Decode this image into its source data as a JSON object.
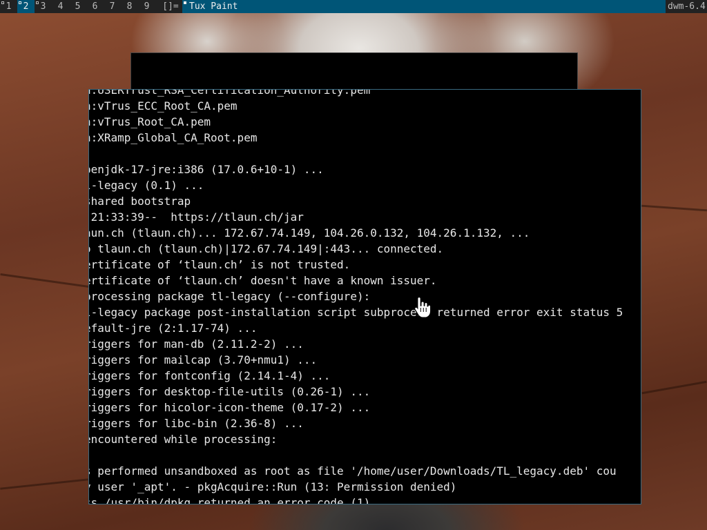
{
  "bar": {
    "tags": [
      {
        "label": "1",
        "occupied": true,
        "selected": false
      },
      {
        "label": "2",
        "occupied": true,
        "selected": true
      },
      {
        "label": "3",
        "occupied": true,
        "selected": false
      },
      {
        "label": "4",
        "occupied": false,
        "selected": false
      },
      {
        "label": "5",
        "occupied": false,
        "selected": false
      },
      {
        "label": "6",
        "occupied": false,
        "selected": false
      },
      {
        "label": "7",
        "occupied": false,
        "selected": false
      },
      {
        "label": "8",
        "occupied": false,
        "selected": false
      },
      {
        "label": "9",
        "occupied": false,
        "selected": false
      }
    ],
    "layout_symbol": "[]=",
    "window_title": "Tux Paint",
    "status_text": "dwm-6.4"
  },
  "colors": {
    "bar_bg": "#222222",
    "bar_fg": "#bbbbbb",
    "selected_bg": "#005577",
    "selected_fg": "#eeeeee",
    "terminal_bg": "#000000",
    "terminal_fg": "#e8e8e8"
  },
  "icons": {
    "cursor": "hand-pointer-icon"
  },
  "terminal": {
    "lines": [
      "n:USERTrust_RSA_Certification_Authority.pem",
      "n:vTrus_ECC_Root_CA.pem",
      "n:vTrus_Root_CA.pem",
      "n:XRamp_Global_CA_Root.pem",
      "",
      "penjdk-17-jre:i386 (17.0.6+10-1) ...",
      "l-legacy (0.1) ...",
      "shared bootstrap",
      " 21:33:39--  https://tlaun.ch/jar",
      "aun.ch (tlaun.ch)... 172.67.74.149, 104.26.0.132, 104.26.1.132, ...",
      "o tlaun.ch (tlaun.ch)|172.67.74.149|:443... connected.",
      "ertificate of ‘tlaun.ch’ is not trusted.",
      "ertificate of ‘tlaun.ch’ doesn't have a known issuer.",
      "processing package tl-legacy (--configure):",
      "l-legacy package post-installation script subprocess returned error exit status 5",
      "efault-jre (2:1.17-74) ...",
      "riggers for man-db (2.11.2-2) ...",
      "riggers for mailcap (3.70+nmu1) ...",
      "riggers for fontconfig (2.14.1-4) ...",
      "riggers for desktop-file-utils (0.26-1) ...",
      "riggers for hicolor-icon-theme (0.17-2) ...",
      "riggers for libc-bin (2.36-8) ...",
      "encountered while processing:",
      "",
      "s performed unsandboxed as root as file '/home/user/Downloads/TL_legacy.deb' cou",
      "y user '_apt'. - pkgAcquire::Run (13: Permission denied)",
      "ss /usr/bin/dpkg returned an error code (1)"
    ]
  }
}
